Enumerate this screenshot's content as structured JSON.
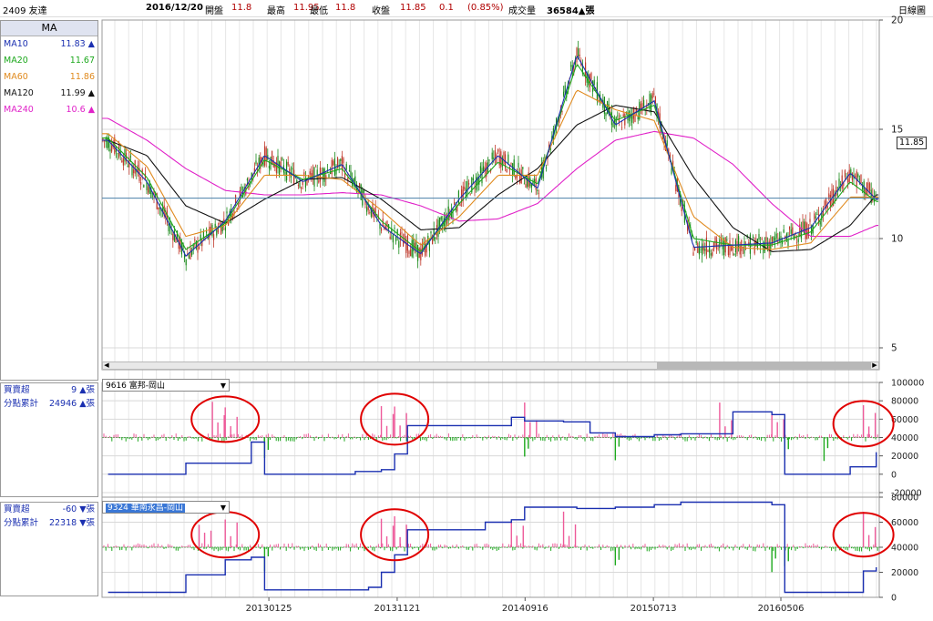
{
  "header": {
    "stock": "2409 友達",
    "date": "2016/12/20",
    "open_label": "開盤",
    "open": "11.8",
    "high_label": "最高",
    "high": "11.95",
    "low_label": "最低",
    "low": "11.8",
    "close_label": "收盤",
    "close": "11.85",
    "change": "0.1",
    "change_pct": "(0.85%)",
    "volume_label": "成交量",
    "volume": "36584▲張",
    "view": "日線圖"
  },
  "ma_panel": {
    "title": "MA",
    "items": [
      {
        "name": "MA10",
        "value": "11.83 ▲",
        "color": "#1a2fb0"
      },
      {
        "name": "MA20",
        "value": "11.67",
        "color": "#1ca81c"
      },
      {
        "name": "MA60",
        "value": "11.86",
        "color": "#e08a1e"
      },
      {
        "name": "MA120",
        "value": "11.99 ▲",
        "color": "#111111"
      },
      {
        "name": "MA240",
        "value": "10.6 ▲",
        "color": "#e020c8"
      }
    ]
  },
  "broker1": {
    "selector": "9616 富邦-岡山",
    "buy_sell_label": "買賣超",
    "buy_sell_value": "9 ▲張",
    "cum_label": "分點累計",
    "cum_value": "24946 ▲張"
  },
  "broker2": {
    "selector": "9324 華南永昌-岡山",
    "buy_sell_label": "買賣超",
    "buy_sell_value": "-60 ▼張",
    "cum_label": "分點累計",
    "cum_value": "22318 ▼張"
  },
  "price_tag": "11.85",
  "colors": {
    "up": "#ee5a9a",
    "down": "#1ca81c",
    "cum": "#1a2fb0",
    "annot": "#e00000"
  },
  "chart_data": [
    {
      "type": "line",
      "name": "price",
      "yticks": [
        "20",
        "15",
        "10",
        "5"
      ],
      "ylim": [
        5,
        20
      ],
      "reference_price": 11.85,
      "x": [
        "2012-01",
        "2012-04",
        "2012-07",
        "2012-10",
        "2013-01",
        "2013-04",
        "2013-07",
        "2013-10",
        "2014-01",
        "2014-04",
        "2014-07",
        "2014-10",
        "2015-01",
        "2015-04",
        "2015-07",
        "2015-10",
        "2016-01",
        "2016-04",
        "2016-07",
        "2016-10",
        "2016-12"
      ],
      "series": [
        {
          "name": "MA10",
          "values": [
            14.5,
            12.6,
            9.2,
            10.8,
            13.8,
            12.6,
            13.4,
            10.6,
            9.3,
            11.8,
            13.8,
            12.3,
            18.4,
            15.2,
            16.3,
            9.6,
            9.7,
            9.8,
            10.5,
            13.0,
            11.8
          ]
        },
        {
          "name": "MA20",
          "values": [
            14.6,
            12.8,
            9.5,
            10.7,
            13.6,
            12.7,
            13.2,
            10.8,
            9.4,
            11.6,
            13.5,
            12.5,
            18.0,
            15.4,
            16.1,
            10.0,
            9.7,
            9.7,
            10.3,
            12.6,
            11.7
          ]
        },
        {
          "name": "MA60",
          "values": [
            14.8,
            13.3,
            10.1,
            10.6,
            12.9,
            12.9,
            12.7,
            11.3,
            9.7,
            11.0,
            12.9,
            12.9,
            16.8,
            15.9,
            15.4,
            11.0,
            9.6,
            9.5,
            9.8,
            11.9,
            11.9
          ]
        },
        {
          "name": "MA120",
          "values": [
            14.5,
            13.8,
            11.5,
            10.7,
            11.8,
            12.7,
            12.8,
            11.8,
            10.4,
            10.5,
            12.0,
            13.2,
            15.2,
            16.1,
            15.8,
            12.8,
            10.5,
            9.4,
            9.5,
            10.6,
            12.0
          ]
        },
        {
          "name": "MA240",
          "values": [
            15.5,
            14.5,
            13.2,
            12.2,
            12.0,
            12.0,
            12.1,
            12.0,
            11.5,
            10.8,
            10.9,
            11.6,
            13.2,
            14.5,
            14.9,
            14.6,
            13.4,
            11.6,
            10.1,
            10.1,
            10.6
          ]
        }
      ]
    },
    {
      "type": "line",
      "name": "broker1",
      "yticks": [
        "100000",
        "80000",
        "60000",
        "40000",
        "20000",
        "0",
        "-20000"
      ],
      "ylim": [
        -20000,
        100000
      ],
      "x": [
        "2012-01",
        "2012-06",
        "2012-07",
        "2012-11",
        "2012-12",
        "2013-01",
        "2013-06",
        "2013-08",
        "2013-10",
        "2013-11",
        "2013-12",
        "2014-04",
        "2014-08",
        "2014-09",
        "2014-12",
        "2015-02",
        "2015-04",
        "2015-07",
        "2015-09",
        "2015-11",
        "2016-01",
        "2016-03",
        "2016-04",
        "2016-05",
        "2016-07",
        "2016-10",
        "2016-12"
      ],
      "values": [
        0,
        0,
        12000,
        12000,
        35000,
        0,
        0,
        3000,
        5000,
        22000,
        53000,
        53000,
        62000,
        58000,
        57000,
        45000,
        41000,
        43000,
        44000,
        44000,
        68000,
        68000,
        65000,
        0,
        0,
        8000,
        24000
      ],
      "bars_up_at": [
        "2012-09",
        "2012-10",
        "2013-10",
        "2013-11",
        "2014-09",
        "2015-12",
        "2016-04",
        "2016-11"
      ],
      "bars_down_at": [
        "2013-01",
        "2014-09",
        "2015-04",
        "2016-05",
        "2016-08"
      ]
    },
    {
      "type": "line",
      "name": "broker2",
      "yticks": [
        "80000",
        "60000",
        "40000",
        "20000",
        "0"
      ],
      "ylim": [
        0,
        80000
      ],
      "x": [
        "2012-01",
        "2012-06",
        "2012-07",
        "2012-10",
        "2012-12",
        "2013-01",
        "2013-06",
        "2013-09",
        "2013-10",
        "2013-11",
        "2013-12",
        "2014-04",
        "2014-06",
        "2014-08",
        "2014-09",
        "2015-01",
        "2015-04",
        "2015-07",
        "2015-09",
        "2015-12",
        "2016-03",
        "2016-04",
        "2016-05",
        "2016-08",
        "2016-11",
        "2016-12"
      ],
      "values": [
        4000,
        4000,
        18000,
        30000,
        32000,
        6000,
        6000,
        8000,
        20000,
        34000,
        54000,
        54000,
        60000,
        62000,
        72000,
        71000,
        72000,
        74000,
        76000,
        76000,
        76000,
        74000,
        4000,
        4000,
        21000,
        24000
      ],
      "bars_up_at": [
        "2012-08",
        "2012-10",
        "2013-10",
        "2013-11",
        "2014-08",
        "2014-12",
        "2016-11"
      ],
      "bars_down_at": [
        "2013-01",
        "2015-04",
        "2016-04",
        "2016-05"
      ]
    }
  ],
  "x_axis_labels": [
    "20130125",
    "20131121",
    "20140916",
    "20150713",
    "20160506"
  ]
}
